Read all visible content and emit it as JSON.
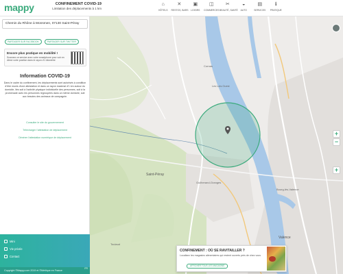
{
  "header": {
    "logo": "mappy",
    "title_line1": "CONFINEMENT COVID-19",
    "title_line2": "Limitation des déplacements à 1 km",
    "categories": [
      {
        "label": "HÔTELS",
        "icon": "hotel-icon"
      },
      {
        "label": "RESTOS, BARS",
        "icon": "restaurant-icon"
      },
      {
        "label": "LOISIRS",
        "icon": "leisure-icon"
      },
      {
        "label": "COMMERCES",
        "icon": "shopping-icon"
      },
      {
        "label": "BEAUTÉ, SANTÉ",
        "icon": "beauty-icon"
      },
      {
        "label": "AUTO",
        "icon": "car-icon"
      },
      {
        "label": "SERVICES",
        "icon": "services-icon"
      },
      {
        "label": "PRATIQUE",
        "icon": "practical-icon"
      }
    ]
  },
  "sidebar": {
    "address": "Chemin du Rhône à Monsmen, 07130 Saint-Péray",
    "share_facebook": "PARTAGER SUR FACEBOOK",
    "share_twitter": "PARTAGER SUR TWITTER",
    "promo_title": "Encore plus pratique en mobilité !",
    "promo_text": "Scannez ce service avec votre smartphone pour voir en direct votre position dans le rayon d'1 kilomètre",
    "info_title": "Information COVID-19",
    "info_text": "Dans le cadre du confinement, les déplacements sont autorisés à condition d'être munis d'une attestation et dans un rayon maximal d'1 km autour du domicile, liés soit à l'activité physique individuelle des personnes, soit à la promenade avec les personnes regroupées dans un même domicile, soit aux besoins des animaux de compagnie.",
    "link1": "Consulter le site du gouvernement",
    "link2": "Télécharger l'attestation de déplacement",
    "link3": "Dénérer l'attestation numérique de déplacement",
    "footer_items": [
      {
        "label": "Mini",
        "icon": "info-icon"
      },
      {
        "label": "Vie privée",
        "icon": "lock-icon"
      },
      {
        "label": "Contact",
        "icon": "mail-icon"
      }
    ],
    "copyright": "Copyright ©Mappy.com 2019 et ©Mérlique en France",
    "lang": "FR"
  },
  "map": {
    "zoom_in": "+",
    "zoom_out": "−",
    "labels": [
      {
        "text": "Saint-Péray",
        "id": "place-saint-peray"
      },
      {
        "text": "Cornas",
        "id": "place-cornas"
      },
      {
        "text": "Guilherand-Granges",
        "id": "place-guilherand"
      },
      {
        "text": "Valence",
        "id": "place-valence"
      },
      {
        "text": "Bourg-lès-Valence",
        "id": "place-bourg"
      },
      {
        "text": "Les Lots Ouest",
        "id": "place-lots-ouest"
      },
      {
        "text": "Toulaud",
        "id": "place-toulaud"
      }
    ],
    "colors": {
      "water": "#a8c8e8",
      "land": "#eeecea",
      "forest": "#cfe0b8",
      "circle": "#3aaa7c"
    }
  },
  "popup": {
    "title": "CONFINEMENT : OÙ SE RAVITAILLER ?",
    "text": "Localisez les magasins alimentaires qui restent ouverts près de chez vous",
    "button": "AFFICHER TOUS LES MAGASINS"
  }
}
